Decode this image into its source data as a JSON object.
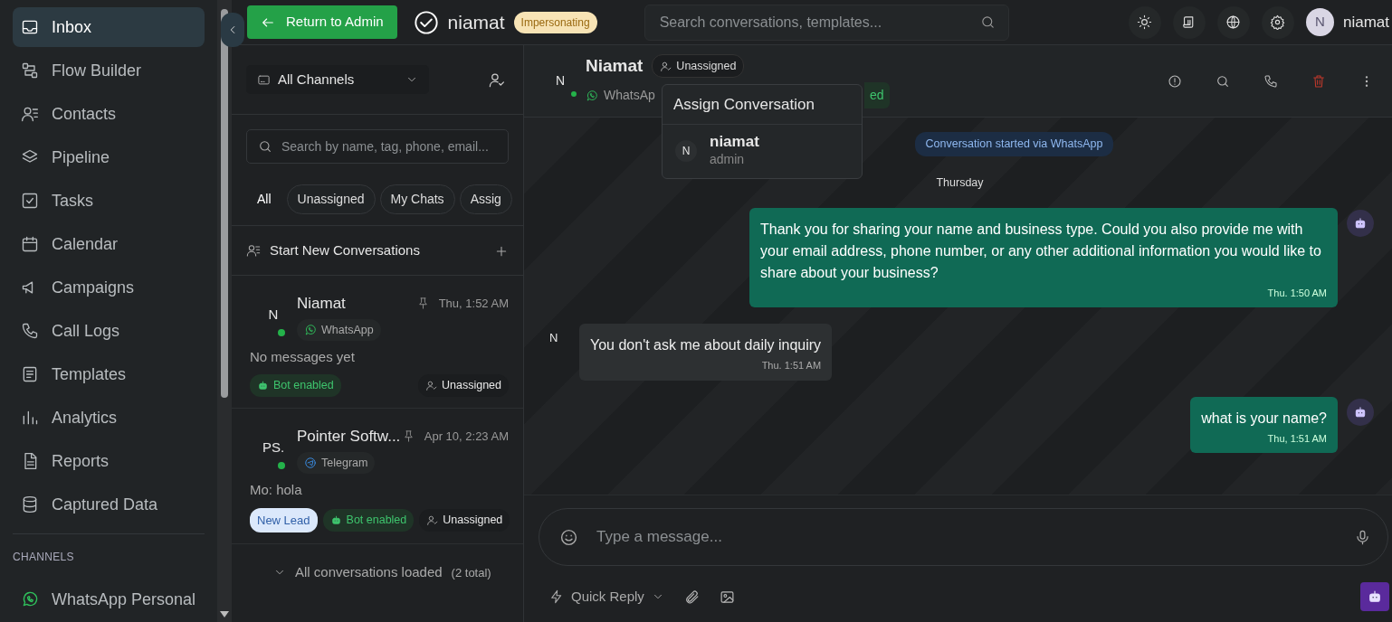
{
  "sidebar": {
    "items": [
      {
        "label": "Inbox",
        "selected": true
      },
      {
        "label": "Flow Builder",
        "selected": false
      },
      {
        "label": "Contacts",
        "selected": false
      },
      {
        "label": "Pipeline",
        "selected": false
      },
      {
        "label": "Tasks",
        "selected": false
      },
      {
        "label": "Calendar",
        "selected": false
      },
      {
        "label": "Campaigns",
        "selected": false
      },
      {
        "label": "Call Logs",
        "selected": false
      },
      {
        "label": "Templates",
        "selected": false
      },
      {
        "label": "Analytics",
        "selected": false
      },
      {
        "label": "Reports",
        "selected": false
      },
      {
        "label": "Captured Data",
        "selected": false
      }
    ],
    "section_title": "CHANNELS",
    "channels": [
      {
        "label": "WhatsApp Personal"
      }
    ]
  },
  "topbar": {
    "back_button": "Return to Admin",
    "user": "niamat",
    "badge": "Impersonating",
    "search": {
      "placeholder": "Search conversations, templates..."
    },
    "account": {
      "avatar": "N",
      "name": "niamat"
    }
  },
  "conversation_list": {
    "channel_filter": "All Channels",
    "search": {
      "placeholder": "Search by name, tag, phone, email..."
    },
    "tabs": [
      {
        "label": "All",
        "selected": true
      },
      {
        "label": "Unassigned",
        "selected": false
      },
      {
        "label": "My Chats",
        "selected": false
      },
      {
        "label": "Assig",
        "selected": false
      }
    ],
    "new_conversation": "Start New Conversations",
    "items": [
      {
        "avatar": "N",
        "name": "Niamat",
        "time": "Thu, 1:52 AM",
        "channel": "WhatsApp",
        "kind": "whatsapp",
        "online": true,
        "preview": "No messages yet",
        "tags": [
          {
            "label": "Bot enabled",
            "kind": "bot"
          }
        ],
        "assignee": "Unassigned"
      },
      {
        "avatar": "PS.",
        "name": "Pointer Softw...",
        "time": "Apr 10, 2:23 AM",
        "channel": "Telegram",
        "kind": "telegram",
        "online": true,
        "preview": "Mo: hola",
        "tags": [
          {
            "label": "New Lead",
            "kind": "lead"
          },
          {
            "label": "Bot enabled",
            "kind": "bot"
          }
        ],
        "assignee": "Unassigned"
      }
    ],
    "footer": {
      "text": "All conversations loaded",
      "count": "(2 total)"
    }
  },
  "chat": {
    "header": {
      "avatar": "N",
      "name": "Niamat",
      "online": true,
      "assignee": "Unassigned",
      "channel": "WhatsAp",
      "badge": "ed"
    },
    "assign_menu": {
      "title": "Assign Conversation",
      "options": [
        {
          "avatar": "N",
          "name": "niamat",
          "role": "admin"
        }
      ]
    },
    "system_note": "Conversation started via WhatsApp",
    "day": "Thursday",
    "messages": [
      {
        "kind": "outgoing",
        "text": "Thank you for sharing your name and business type. Could you also provide me with your email address, phone number, or any other additional information you would like to share about your business?",
        "time": "Thu. 1:50 AM"
      },
      {
        "kind": "incoming",
        "avatar": "N",
        "text": "You don't ask me about daily inquiry",
        "time": "Thu. 1:51 AM"
      },
      {
        "kind": "outgoing",
        "text": "what is your name?",
        "time": "Thu, 1:51 AM"
      }
    ],
    "composer": {
      "placeholder": "Type a message..."
    },
    "quick_reply": "Quick Reply"
  }
}
